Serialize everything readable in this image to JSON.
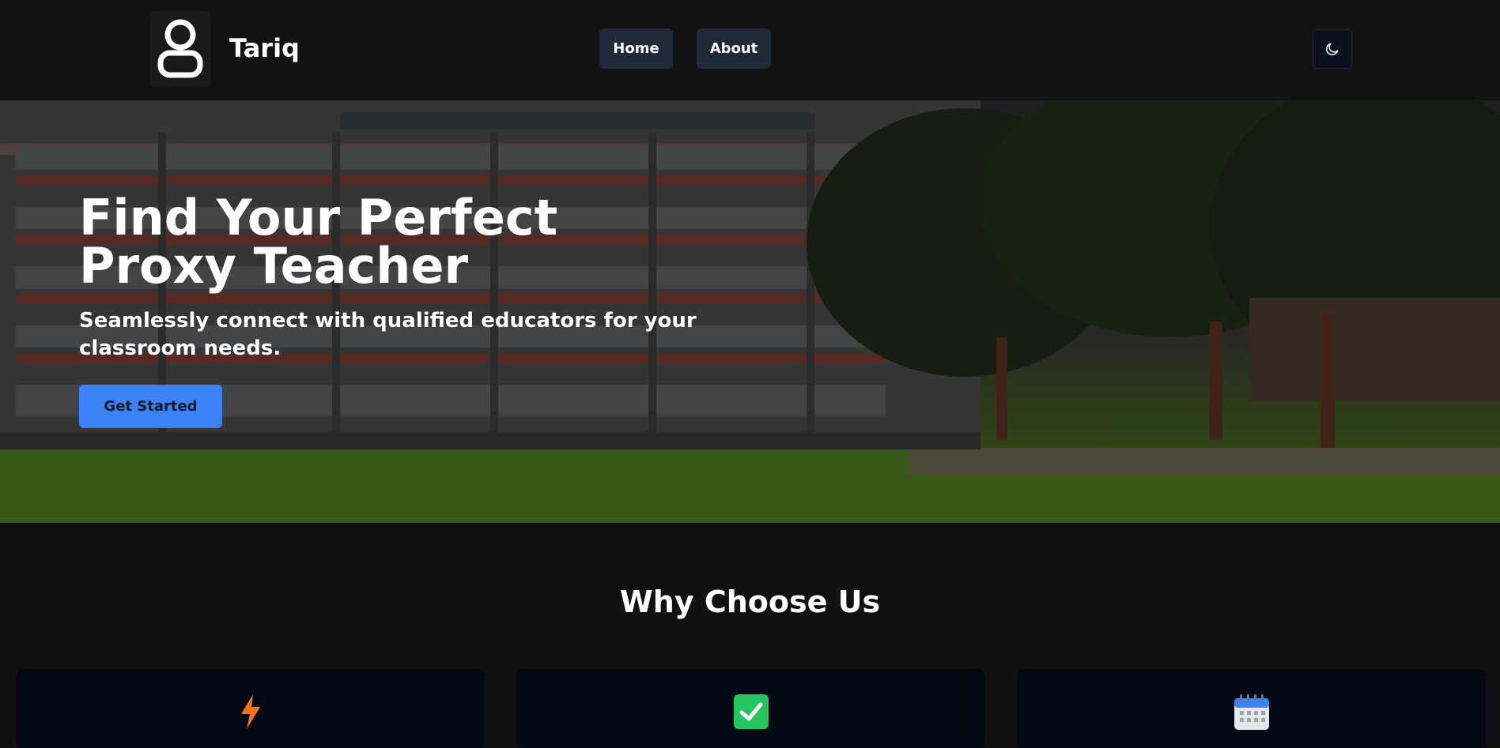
{
  "header": {
    "brand": "Tariq",
    "logo_icon": "user-icon",
    "nav": [
      {
        "label": "Home"
      },
      {
        "label": "About"
      }
    ],
    "theme_toggle_icon": "moon-icon"
  },
  "hero": {
    "title": "Find Your Perfect Proxy Teacher",
    "subtitle": "Seamlessly connect with qualified educators for your classroom needs.",
    "cta_label": "Get Started",
    "cta_color": "#3b82f6"
  },
  "features": {
    "title": "Why Choose Us",
    "cards": [
      {
        "icon": "lightning-icon",
        "color": "#f97316"
      },
      {
        "icon": "checkmark-icon",
        "color": "#22c55e"
      },
      {
        "icon": "calendar-icon",
        "color": "#3b82f6"
      }
    ]
  }
}
